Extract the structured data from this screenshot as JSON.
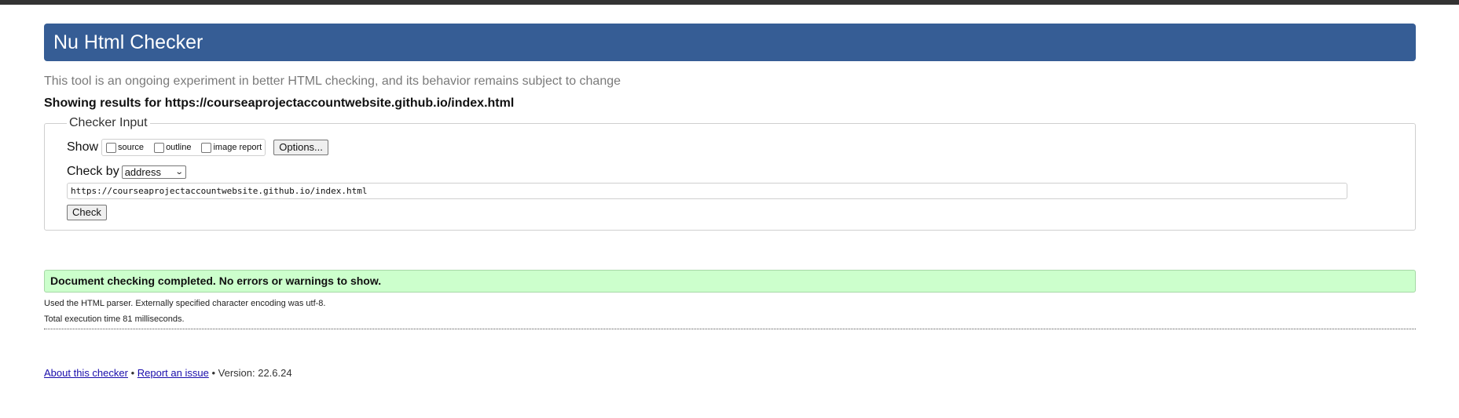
{
  "header": {
    "title": "Nu Html Checker"
  },
  "subtitle": "This tool is an ongoing experiment in better HTML checking, and its behavior remains subject to change",
  "results_for": "Showing results for https://courseaprojectaccountwebsite.github.io/index.html",
  "checker_input": {
    "legend": "Checker Input",
    "show_label": "Show",
    "show_options": [
      {
        "label": "source",
        "checked": false
      },
      {
        "label": "outline",
        "checked": false
      },
      {
        "label": "image report",
        "checked": false
      }
    ],
    "options_button": "Options...",
    "check_by_label": "Check by",
    "check_by_value": "address",
    "url_value": "https://courseaprojectaccountwebsite.github.io/index.html",
    "check_button": "Check"
  },
  "result": {
    "message": "Document checking completed. No errors or warnings to show.",
    "parser_note": "Used the HTML parser. Externally specified character encoding was utf-8.",
    "execution_time": "Total execution time 81 milliseconds."
  },
  "footer": {
    "about_link": "About this checker",
    "separator": "•",
    "report_link": "Report an issue",
    "version": "Version: 22.6.24"
  },
  "colors": {
    "banner": "#365d95",
    "success_bg": "#ccffcc",
    "link": "#1a0dab"
  }
}
